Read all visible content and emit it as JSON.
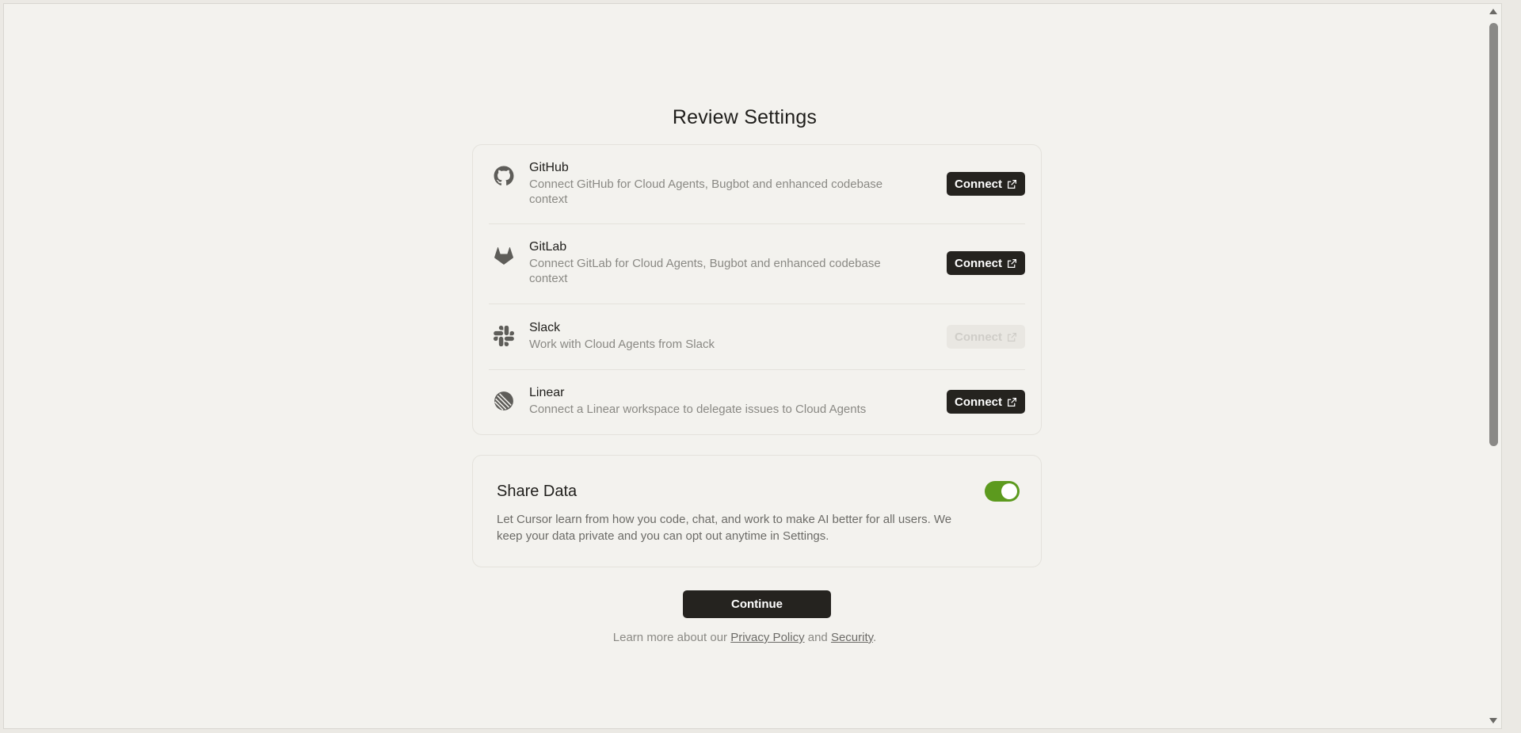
{
  "page": {
    "title": "Review Settings"
  },
  "integrations": [
    {
      "name": "GitHub",
      "icon": "github-icon",
      "description": "Connect GitHub for Cloud Agents, Bugbot and enhanced codebase context",
      "button_label": "Connect",
      "enabled": true
    },
    {
      "name": "GitLab",
      "icon": "gitlab-icon",
      "description": "Connect GitLab for Cloud Agents, Bugbot and enhanced codebase context",
      "button_label": "Connect",
      "enabled": true
    },
    {
      "name": "Slack",
      "icon": "slack-icon",
      "description": "Work with Cloud Agents from Slack",
      "button_label": "Connect",
      "enabled": false
    },
    {
      "name": "Linear",
      "icon": "linear-icon",
      "description": "Connect a Linear workspace to delegate issues to Cloud Agents",
      "button_label": "Connect",
      "enabled": true
    }
  ],
  "share_data": {
    "title": "Share Data",
    "description": "Let Cursor learn from how you code, chat, and work to make AI better for all users. We keep your data private and you can opt out anytime in Settings.",
    "enabled": true,
    "toggle_color": "#5c9a1e"
  },
  "continue_label": "Continue",
  "footer": {
    "prefix": "Learn more about our",
    "privacy_link": "Privacy Policy",
    "middle": "and",
    "security_link": "Security",
    "suffix": "."
  },
  "colors": {
    "background": "#f3f2ee",
    "primary_button": "#25231f",
    "muted_text": "#8a8984"
  }
}
